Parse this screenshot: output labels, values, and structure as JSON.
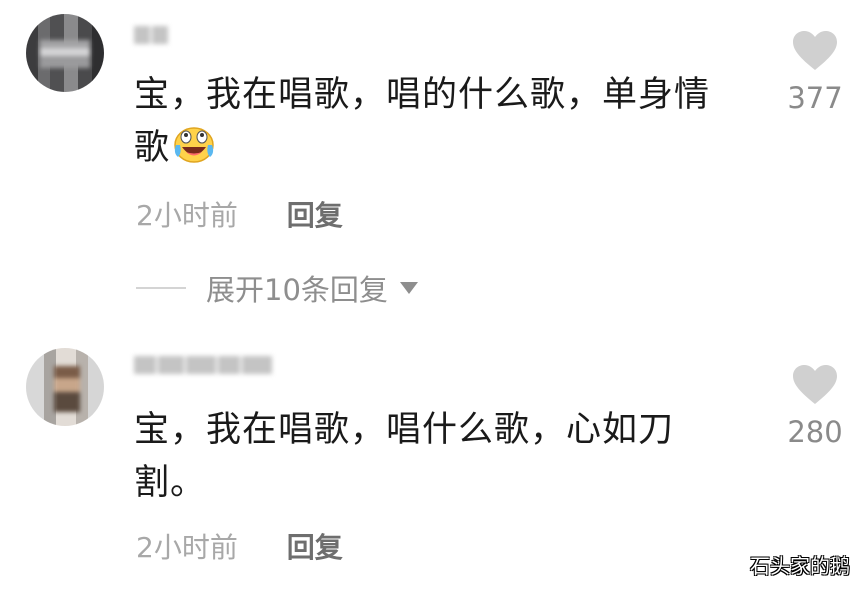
{
  "comments": [
    {
      "text_line1": "宝，我在唱歌，唱的什么歌，单身情",
      "text_line2": "歌",
      "emoji": "laughing-crying-emoji",
      "time": "2小时前",
      "reply_label": "回复",
      "like_count": "377",
      "expand_label": "展开10条回复"
    },
    {
      "text_line1": "宝，我在唱歌，唱什么歌，心如刀",
      "text_line2": "割。",
      "time": "2小时前",
      "reply_label": "回复",
      "like_count": "280"
    }
  ],
  "watermark": "石头家的鹅",
  "colors": {
    "text": "#1a1a1a",
    "meta": "#a8a8a8",
    "reply": "#6e6e6e",
    "heart": "#d0d0d0"
  }
}
